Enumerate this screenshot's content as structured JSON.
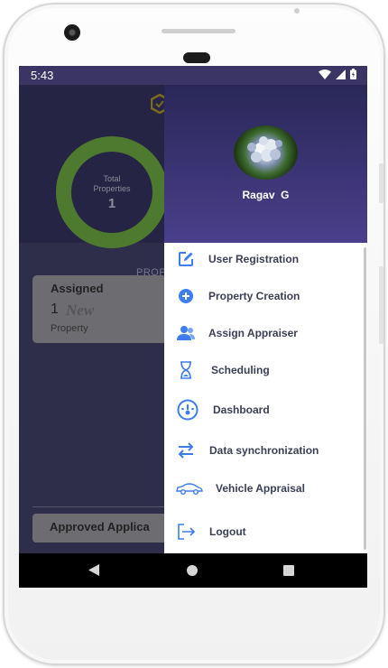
{
  "status_bar": {
    "time": "5:43",
    "icons": [
      "wifi-icon",
      "cell-signal-icon",
      "battery-icon"
    ]
  },
  "background_app": {
    "total_properties_label": "Total Properties",
    "total_properties_count": "1",
    "tab_label": "PROP",
    "assigned_card": {
      "title": "Assigned",
      "count": "1",
      "badge": "New",
      "subtitle": "Property"
    },
    "approved_card": {
      "title": "Approved Applica"
    }
  },
  "drawer": {
    "user_name": "Ragav  G",
    "menu": [
      {
        "label": "User Registration",
        "icon": "edit-icon"
      },
      {
        "label": "Property Creation",
        "icon": "add-circle-icon"
      },
      {
        "label": "Assign Appraiser",
        "icon": "users-icon"
      },
      {
        "label": "Scheduling",
        "icon": "hourglass-icon"
      },
      {
        "label": "Dashboard",
        "icon": "speedometer-icon"
      },
      {
        "label": "Data synchronization",
        "icon": "sync-arrows-icon"
      },
      {
        "label": "Vehicle Appraisal",
        "icon": "car-icon"
      },
      {
        "label": "Logout",
        "icon": "logout-icon"
      }
    ]
  },
  "colors": {
    "accent": "#3d7df0",
    "drawer_header_top": "#2a2758",
    "drawer_header_bottom": "#4a3f8b",
    "donut": "#4d7a2f",
    "menu_text": "#3b3f55"
  }
}
